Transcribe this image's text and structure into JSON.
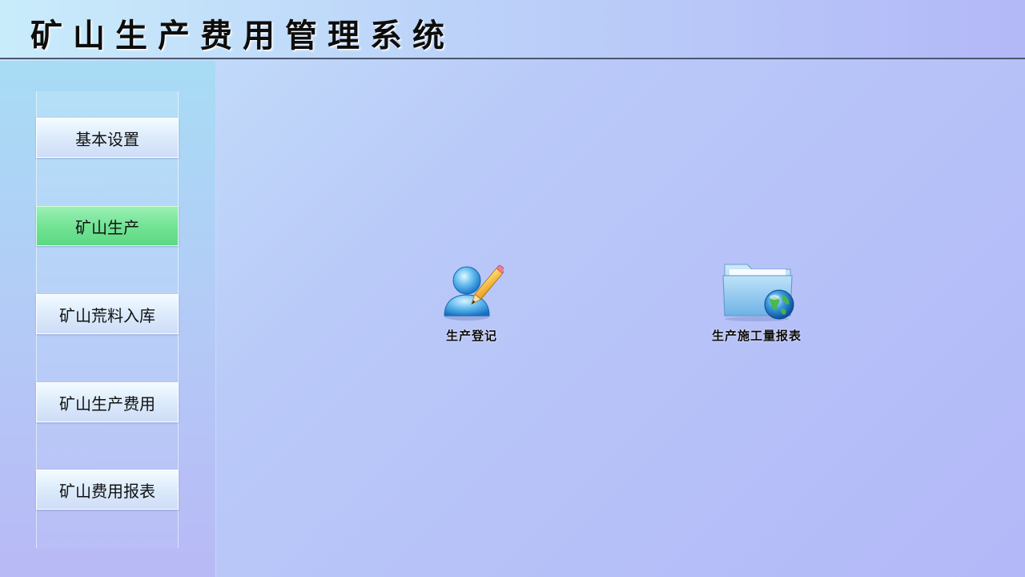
{
  "header": {
    "title": "矿山生产费用管理系统"
  },
  "sidebar": {
    "items": [
      {
        "label": "基本设置",
        "active": false
      },
      {
        "label": "矿山生产",
        "active": true
      },
      {
        "label": "矿山荒料入库",
        "active": false
      },
      {
        "label": "矿山生产费用",
        "active": false
      },
      {
        "label": "矿山费用报表",
        "active": false
      }
    ]
  },
  "main": {
    "shortcuts": [
      {
        "label": "生产登记",
        "icon": "user-edit-icon"
      },
      {
        "label": "生产施工量报表",
        "icon": "folder-globe-icon"
      }
    ]
  },
  "colors": {
    "active_nav": "#73e395",
    "background": "#b9c9f8"
  }
}
